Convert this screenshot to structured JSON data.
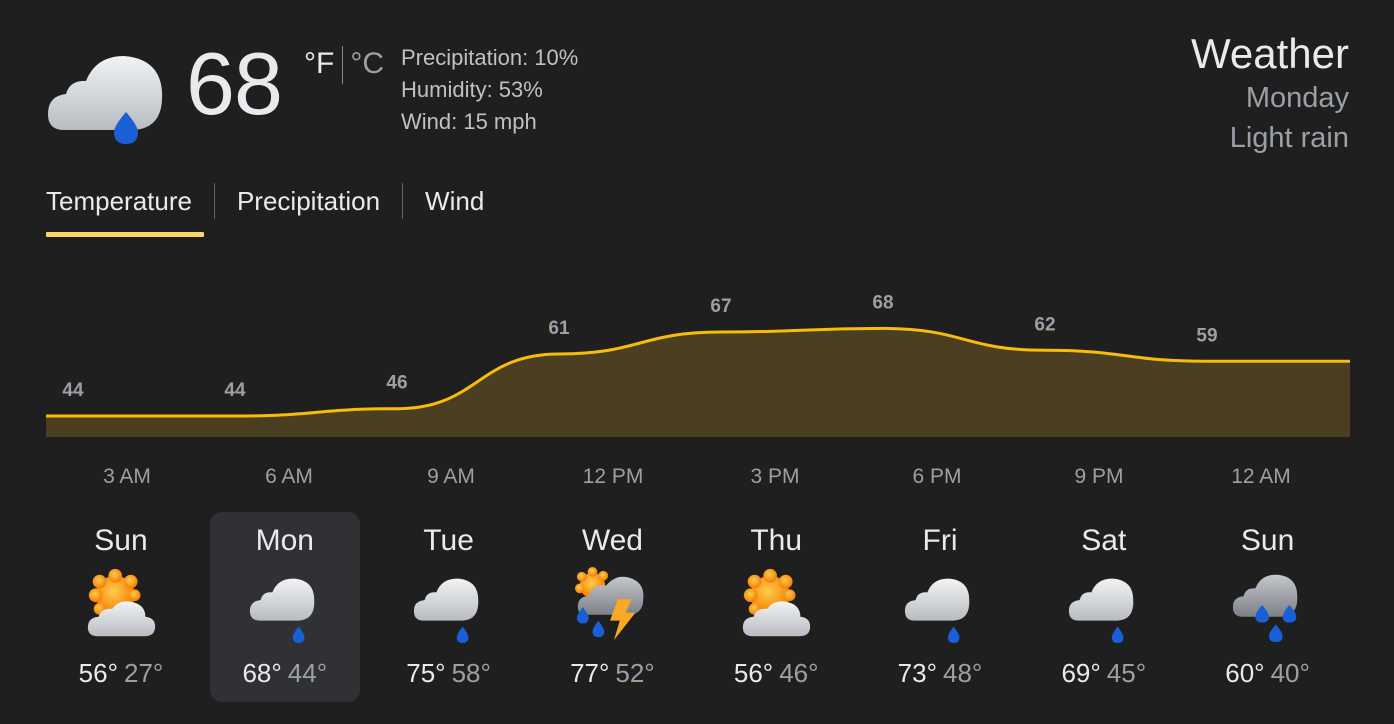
{
  "current": {
    "temp": "68",
    "unit_f": "°F",
    "unit_c": "°C",
    "icon": "cloud-rain-icon",
    "precipitation": "Precipitation: 10%",
    "humidity": "Humidity: 53%",
    "wind": "Wind: 15 mph"
  },
  "summary": {
    "title": "Weather",
    "day": "Monday",
    "condition": "Light rain"
  },
  "tabs": [
    {
      "label": "Temperature",
      "active": true
    },
    {
      "label": "Precipitation",
      "active": false
    },
    {
      "label": "Wind",
      "active": false
    }
  ],
  "colors": {
    "accent": "#fdd663",
    "line": "#fbbc04",
    "area_fill": "#4b3f22",
    "rain_drop": "#1a5fd6",
    "sun": "#f9a825"
  },
  "chart_data": {
    "type": "area",
    "x": [
      "3 AM",
      "6 AM",
      "9 AM",
      "12 PM",
      "3 PM",
      "6 PM",
      "9 PM",
      "12 AM"
    ],
    "values": [
      44,
      44,
      46,
      61,
      67,
      68,
      62,
      59
    ],
    "labels": [
      "44",
      "44",
      "46",
      "61",
      "67",
      "68",
      "62",
      "59"
    ]
  },
  "forecast": [
    {
      "day": "Sun",
      "icon": "partly-cloudy-icon",
      "high": "56°",
      "low": "27°",
      "selected": false
    },
    {
      "day": "Mon",
      "icon": "cloud-rain-icon",
      "high": "68°",
      "low": "44°",
      "selected": true
    },
    {
      "day": "Tue",
      "icon": "cloud-rain-icon",
      "high": "75°",
      "low": "58°",
      "selected": false
    },
    {
      "day": "Wed",
      "icon": "thunderstorm-icon",
      "high": "77°",
      "low": "52°",
      "selected": false
    },
    {
      "day": "Thu",
      "icon": "partly-cloudy-icon",
      "high": "56°",
      "low": "46°",
      "selected": false
    },
    {
      "day": "Fri",
      "icon": "cloud-rain-icon",
      "high": "73°",
      "low": "48°",
      "selected": false
    },
    {
      "day": "Sat",
      "icon": "cloud-rain-icon",
      "high": "69°",
      "low": "45°",
      "selected": false
    },
    {
      "day": "Sun",
      "icon": "heavy-rain-icon",
      "high": "60°",
      "low": "40°",
      "selected": false
    }
  ]
}
